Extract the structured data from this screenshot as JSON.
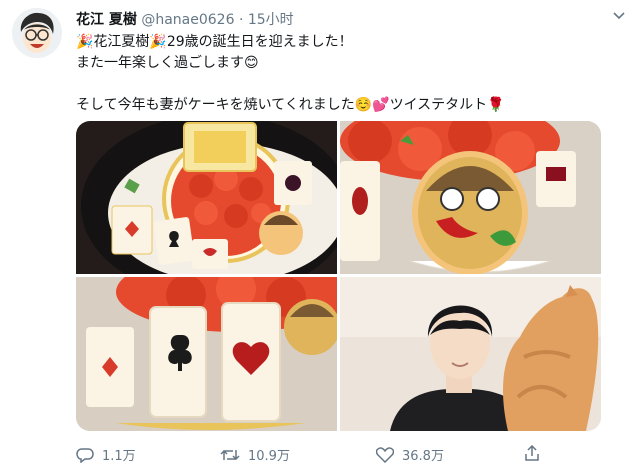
{
  "tweet": {
    "display_name": "花江 夏樹",
    "handle": "@hanae0626",
    "separator": "·",
    "timestamp": "15小时",
    "lines": [
      "🎉花江夏樹🎉29歳の誕生日を迎えました！",
      "また一年楽しく過ごします😊",
      "そして今年も妻がケーキを焼いてくれました☺️💕ツイステタルト🌹"
    ]
  },
  "actions": {
    "reply_icon": "reply-icon",
    "reply_count": "1.1万",
    "retweet_icon": "retweet-icon",
    "retweet_count": "10.9万",
    "like_icon": "heart-icon",
    "like_count": "36.8万",
    "share_icon": "share-icon"
  },
  "menu_icon": "chevron-down-icon",
  "colors": {
    "text_primary": "#14171a",
    "text_secondary": "#657786",
    "cake_red": "#e64a2e",
    "cookie_cream": "#fbf3e4",
    "gold": "#e8c45a"
  }
}
